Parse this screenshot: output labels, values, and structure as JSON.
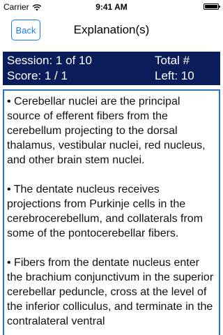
{
  "status_bar": {
    "carrier": "Carrier",
    "time": "9:41 AM"
  },
  "nav": {
    "back_label": "Back",
    "title": "Explanation(s)"
  },
  "info": {
    "session": "Session: 1 of 10",
    "score": "Score: 1 / 1",
    "total": "Total #",
    "left": "Left: 10"
  },
  "explanation": {
    "paragraphs": [
      "• Cerebellar nuclei are the principal source of efferent fibers from the cerebellum projecting to the dorsal thalamus, vestibular nuclei, red nucleus, and other brain stem nuclei.",
      "• The dentate nucleus receives projections from Purkinje cells in the cerebrocerebellum, and collaterals from some of the pontocerebellar fibers.",
      "• Fibers from the dentate nucleus enter the brachium conjunctivum in the superior cerebellar peduncle, cross at the level of the inferior colliculus, and terminate in the contralateral ventral"
    ]
  },
  "colors": {
    "accent": "#1a7cf6",
    "panel": "#0b1c5a",
    "box_border": "#2e74b8"
  }
}
